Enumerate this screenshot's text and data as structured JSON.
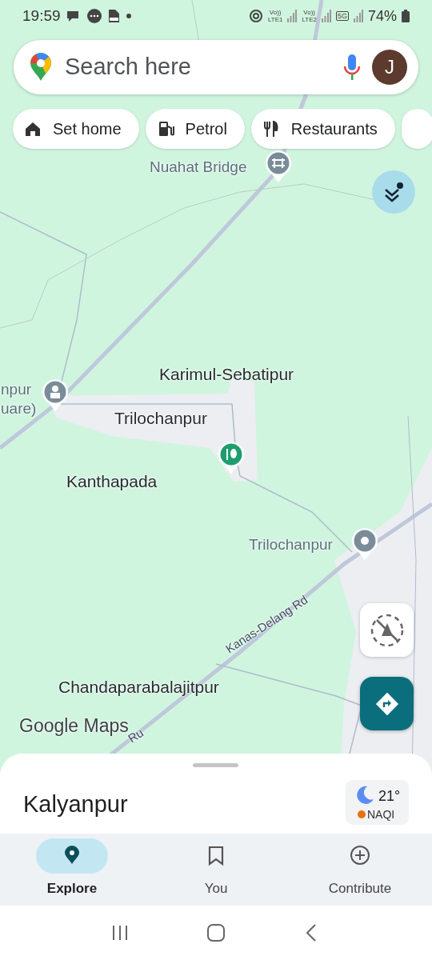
{
  "status_bar": {
    "time": "19:59",
    "sims": [
      {
        "top": "Vo))",
        "bottom": "LTE1"
      },
      {
        "top": "Vo))",
        "bottom": "LTE2"
      }
    ],
    "network": "5G",
    "battery": "74%"
  },
  "search": {
    "placeholder": "Search here",
    "avatar": "J"
  },
  "chips": [
    {
      "label": "Set home",
      "kind": "home"
    },
    {
      "label": "Petrol",
      "kind": "fuel"
    },
    {
      "label": "Restaurants",
      "kind": "food"
    }
  ],
  "map_labels": [
    {
      "text": "Nuahat Bridge",
      "kind": "poi"
    },
    {
      "text": "Karimul-Sebatipur",
      "kind": "place"
    },
    {
      "text": "npur",
      "kind": "poi"
    },
    {
      "text": "uare)",
      "kind": "poi"
    },
    {
      "text": "Trilochanpur",
      "kind": "place"
    },
    {
      "text": "Kanthapada",
      "kind": "place"
    },
    {
      "text": "Trilochanpur",
      "kind": "poi"
    },
    {
      "text": "Kanas-Delang Rd",
      "kind": "road"
    },
    {
      "text": "Chandaparabalajitpur",
      "kind": "place"
    },
    {
      "text": "Ru",
      "kind": "road"
    }
  ],
  "logo": "Google Maps",
  "place": {
    "name": "Kalyanpur"
  },
  "weather": {
    "temp": "21°",
    "aqi": "NAQI",
    "color": "#e8710a"
  },
  "nav": [
    {
      "label": "Explore",
      "kind": "explore",
      "selected": true
    },
    {
      "label": "You",
      "kind": "saved",
      "selected": false
    },
    {
      "label": "Contribute",
      "kind": "contribute",
      "selected": false
    }
  ]
}
